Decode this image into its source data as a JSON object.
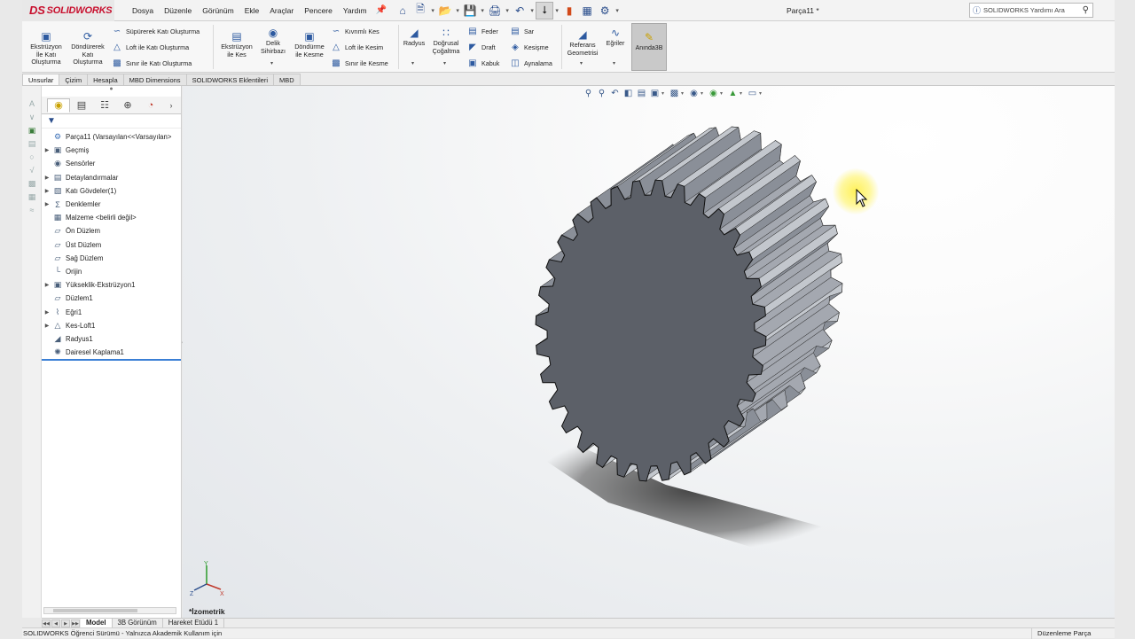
{
  "app": {
    "logo_ds": "DS",
    "logo_text": "SOLIDWORKS",
    "document_title": "Parça11 *"
  },
  "menu": [
    "Dosya",
    "Düzenle",
    "Görünüm",
    "Ekle",
    "Araçlar",
    "Pencere",
    "Yardım"
  ],
  "quick_access_icons": [
    "home-icon",
    "new-file-icon",
    "open-file-icon",
    "save-icon",
    "print-icon",
    "undo-icon",
    "select-icon",
    "rebuild-icon",
    "file-properties-icon",
    "options-icon"
  ],
  "help_search": {
    "placeholder": "SOLIDWORKS Yardımı Ara"
  },
  "ribbon": {
    "extruded_boss": "Ekstrüzyon\nİle Katı\nOluşturma",
    "revolved_boss": "Döndürerek\nKatı\nOluşturma",
    "swept_boss": "Süpürerek Katı Oluşturma",
    "lofted_boss": "Loft ile Katı Oluşturma",
    "boundary_boss": "Sınır ile Katı Oluşturma",
    "extruded_cut": "Ekstrüzyon\nile Kes",
    "hole_wizard": "Delik\nSihirbazı",
    "revolved_cut": "Döndürme\nile Kesme",
    "swept_cut": "Kıvrımlı Kes",
    "lofted_cut": "Loft ile Kesim",
    "boundary_cut": "Sınır ile Kesme",
    "fillet": "Radyus",
    "linear_pattern": "Doğrusal\nÇoğaltma",
    "rib": "Feder",
    "draft": "Draft",
    "shell": "Kabuk",
    "wrap": "Sar",
    "intersect": "Kesişme",
    "mirror": "Aynalama",
    "reference_geometry": "Referans\nGeometrisi",
    "curves": "Eğriler",
    "instant3d": "Anında3B"
  },
  "command_tabs": [
    "Unsurlar",
    "Çizim",
    "Hesapla",
    "MBD Dimensions",
    "SOLIDWORKS Eklentileri",
    "MBD"
  ],
  "feature_tree": [
    {
      "label": "Parça11  (Varsayılan<<Varsayılan>",
      "icon": "part-icon",
      "expandable": false,
      "root": true
    },
    {
      "label": "Geçmiş",
      "icon": "history-icon",
      "expandable": true
    },
    {
      "label": "Sensörler",
      "icon": "sensors-icon",
      "expandable": false
    },
    {
      "label": "Detaylandırmalar",
      "icon": "annotations-icon",
      "expandable": true
    },
    {
      "label": "Katı Gövdeler(1)",
      "icon": "solid-bodies-icon",
      "expandable": true
    },
    {
      "label": "Denklemler",
      "icon": "equations-icon",
      "expandable": true
    },
    {
      "label": "Malzeme <belirli değil>",
      "icon": "material-icon",
      "expandable": false
    },
    {
      "label": "Ön Düzlem",
      "icon": "plane-icon",
      "expandable": false
    },
    {
      "label": "Üst Düzlem",
      "icon": "plane-icon",
      "expandable": false
    },
    {
      "label": "Sağ Düzlem",
      "icon": "plane-icon",
      "expandable": false
    },
    {
      "label": "Orijin",
      "icon": "origin-icon",
      "expandable": false
    },
    {
      "label": "Yükseklik-Ekstrüzyon1",
      "icon": "extrude-feature-icon",
      "expandable": true
    },
    {
      "label": "Düzlem1",
      "icon": "plane-icon",
      "expandable": false
    },
    {
      "label": "Eğri1",
      "icon": "curve-icon",
      "expandable": true
    },
    {
      "label": "Kes-Loft1",
      "icon": "loft-cut-icon",
      "expandable": true
    },
    {
      "label": "Radyus1",
      "icon": "fillet-feature-icon",
      "expandable": false
    },
    {
      "label": "Dairesel Kaplama1",
      "icon": "circular-pattern-icon",
      "expandable": false
    }
  ],
  "viewport": {
    "view_name": "*İzometrik",
    "triad_x": "X",
    "triad_y": "Y",
    "triad_z": "Z"
  },
  "bottom_tabs": [
    "Model",
    "3B Görünüm",
    "Hareket Etüdü 1"
  ],
  "status": {
    "left": "SOLIDWORKS Öğrenci Sürümü - Yalnızca Akademik Kullanım için",
    "right": "Düzenleme Parça"
  },
  "colors": {
    "gear_face": "#5c6068",
    "gear_side": "#8a8f98",
    "accent": "#3a7fd5",
    "logo_red": "#c8102e"
  }
}
